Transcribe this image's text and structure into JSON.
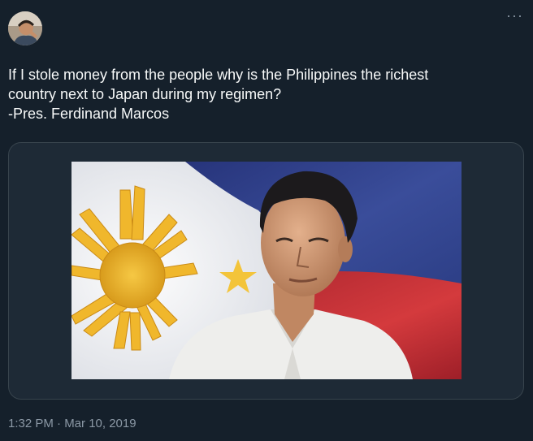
{
  "tweet": {
    "more_label": "···",
    "text_lines": [
      "If I stole money from the people why is the Philippines the richest",
      "country next to Japan during my regimen?",
      "-Pres. Ferdinand Marcos"
    ],
    "timestamp": "1:32 PM · Mar 10, 2019",
    "media": {
      "description_icon": "photo-portrait-flag"
    }
  },
  "colors": {
    "background": "#15202b",
    "text": "#f7f9f9",
    "muted": "#8b98a5",
    "card_border": "#38444d"
  }
}
